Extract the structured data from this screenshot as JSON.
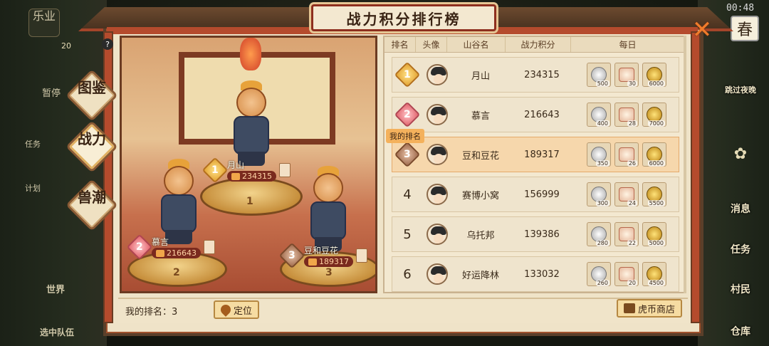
{
  "title": "战力积分排行榜",
  "hud_left": {
    "top_label": "乐业",
    "level_badge": "20",
    "pause": "暂停",
    "task": "任务",
    "plan": "计划",
    "world": "世界",
    "bottom": "选中队伍"
  },
  "hud_right": {
    "time": "00:48",
    "season": "春",
    "skip_night": "跳过夜晚",
    "message": "消息",
    "task": "任务",
    "villager": "村民",
    "warehouse": "仓库"
  },
  "tabs": [
    {
      "label": "图鉴"
    },
    {
      "label": "战力"
    },
    {
      "label": "兽潮"
    }
  ],
  "help_icon": "?",
  "podium": [
    {
      "rank": "1",
      "name": "月山",
      "score": "234315",
      "pedestal_num": "1"
    },
    {
      "rank": "2",
      "name": "慕言",
      "score": "216643",
      "pedestal_num": "2"
    },
    {
      "rank": "3",
      "name": "豆和豆花",
      "score": "189317",
      "pedestal_num": "3"
    }
  ],
  "table": {
    "headers": [
      "排名",
      "头像",
      "山谷名",
      "战力积分",
      "每日"
    ],
    "my_rank_badge": "我的排名",
    "rows": [
      {
        "rank": "1",
        "name": "月山",
        "score": "234315",
        "rewards": [
          "500",
          "30",
          "6000"
        ]
      },
      {
        "rank": "2",
        "name": "慕言",
        "score": "216643",
        "rewards": [
          "400",
          "28",
          "7000"
        ]
      },
      {
        "rank": "3",
        "name": "豆和豆花",
        "score": "189317",
        "rewards": [
          "350",
          "26",
          "6000"
        ]
      },
      {
        "rank": "4",
        "name": "赛博小窝",
        "score": "156999",
        "rewards": [
          "300",
          "24",
          "5500"
        ]
      },
      {
        "rank": "5",
        "name": "乌托邦",
        "score": "139386",
        "rewards": [
          "280",
          "22",
          "5000"
        ]
      },
      {
        "rank": "6",
        "name": "好运降林",
        "score": "133032",
        "rewards": [
          "260",
          "20",
          "4500"
        ]
      }
    ]
  },
  "bottom": {
    "my_rank": "我的排名：3",
    "locate": "定位",
    "shop": "虎币商店"
  },
  "colors": {
    "frame": "#b54b2d",
    "panel": "#efe3c8",
    "highlight_row": "#f6d7ac",
    "close": "#f07b2b"
  }
}
